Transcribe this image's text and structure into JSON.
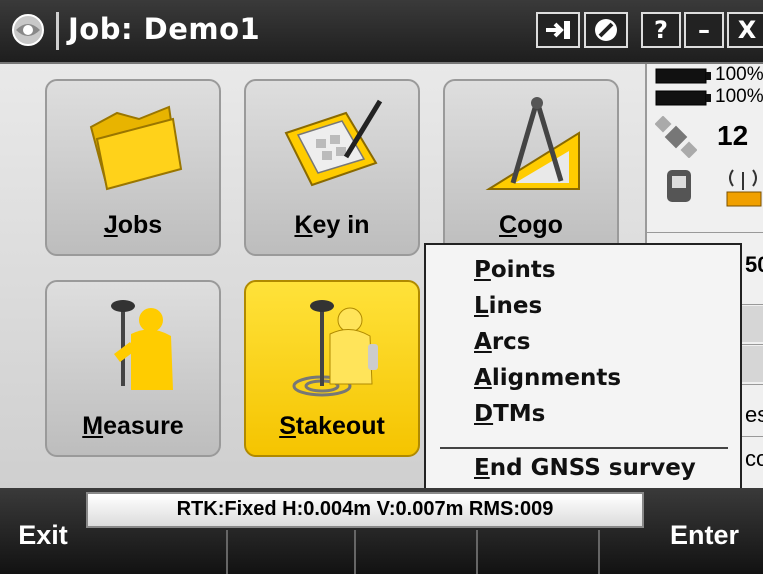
{
  "title_bar": {
    "title": "Job: Demo1",
    "buttons": {
      "help": "?",
      "minimize": "–",
      "close": "X"
    },
    "icons": [
      "trimble-logo-icon",
      "switch-to-icon",
      "no-entry-icon"
    ]
  },
  "main": {
    "tiles": [
      {
        "label": "Jobs",
        "key": "J",
        "rest": "obs",
        "icon": "folder-icon"
      },
      {
        "label": "Key in",
        "key": "K",
        "rest": "ey in",
        "icon": "keypad-icon"
      },
      {
        "label": "Cogo",
        "key": "C",
        "rest": "ogo",
        "icon": "compass-icon"
      },
      {
        "label": "Measure",
        "key": "M",
        "rest": "easure",
        "icon": "survey-rod-icon"
      },
      {
        "label": "Stakeout",
        "key": "S",
        "rest": "takeout",
        "icon": "stakeout-icon",
        "selected": true
      }
    ]
  },
  "status_panel": {
    "battery1": "100%",
    "battery2": "100%",
    "satellites": "12",
    "partial_values": [
      "50",
      "es",
      "co"
    ]
  },
  "popup_menu": {
    "items": [
      {
        "key": "P",
        "rest": "oints"
      },
      {
        "key": "L",
        "rest": "ines"
      },
      {
        "key": "A",
        "rest": "rcs"
      },
      {
        "key": "A",
        "rest": "lignments"
      },
      {
        "key": "D",
        "rest": "TMs"
      }
    ],
    "end_item": {
      "key": "E",
      "rest": "nd GNSS survey"
    }
  },
  "bottom_bar": {
    "gnss_status": "RTK:Fixed H:0.004m V:0.007m RMS:009",
    "exit_label": "Exit",
    "enter_label": "Enter"
  },
  "colors": {
    "selected_tile": "#f5c400",
    "tile": "#c8c8c8",
    "title_bar": "#2a2a2a"
  }
}
